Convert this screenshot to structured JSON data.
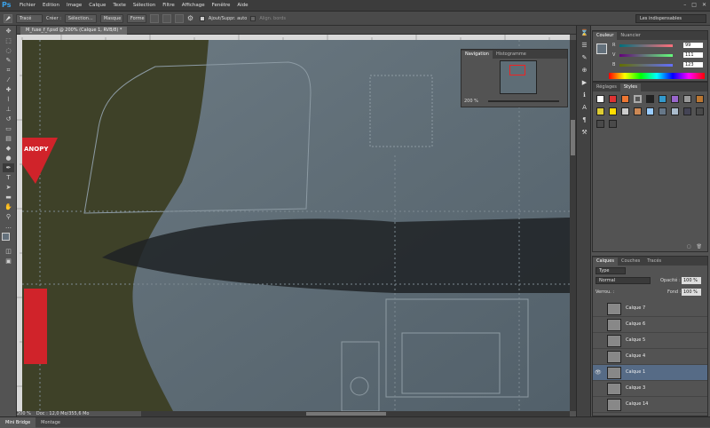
{
  "app": {
    "logo": "Ps"
  },
  "menu": [
    "Fichier",
    "Edition",
    "Image",
    "Calque",
    "Texte",
    "Sélection",
    "Filtre",
    "Affichage",
    "Fenêtre",
    "Aide"
  ],
  "window_controls": [
    "–",
    "□",
    "✕"
  ],
  "options": {
    "tool_dropdown": "Tracé",
    "create_label": "Créer :",
    "btn_selection": "Sélection...",
    "btn_mask": "Masque",
    "btn_shape": "Forme",
    "auto_add_label": "Ajout/Suppr. auto",
    "align_edges_label": "Align. bords",
    "workspace": "Les indispensables"
  },
  "document": {
    "tab_label": "M_fuse_f_f.psd @ 200% (Calque 1, RVB/8) *",
    "zoom": "200 %",
    "doc_info": "Doc : 12,0 Mo/355,6 Mo",
    "canvas_text": "ANOPY"
  },
  "navigator": {
    "tabs": [
      "Navigation",
      "Histogramme"
    ],
    "zoom": "200 %"
  },
  "color": {
    "tabs": [
      "Couleur",
      "Nuancier"
    ],
    "channels": [
      {
        "label": "R",
        "value": "99"
      },
      {
        "label": "V",
        "value": "111"
      },
      {
        "label": "B",
        "value": "123"
      }
    ]
  },
  "styles": {
    "tabs": [
      "Réglages",
      "Styles"
    ]
  },
  "layers": {
    "tabs": [
      "Calques",
      "Couches",
      "Tracés"
    ],
    "filter": "Type",
    "blend_mode": "Normal",
    "opacity_label": "Opacité :",
    "opacity": "100 %",
    "lock_label": "Verrou. :",
    "fill_label": "Fond :",
    "fill": "100 %",
    "items": [
      {
        "name": "Calque 7",
        "visible": false,
        "selected": false
      },
      {
        "name": "Calque 6",
        "visible": false,
        "selected": false
      },
      {
        "name": "Calque 5",
        "visible": false,
        "selected": false
      },
      {
        "name": "Calque 4",
        "visible": false,
        "selected": false
      },
      {
        "name": "Calque 1",
        "visible": true,
        "selected": true
      },
      {
        "name": "Calque 3",
        "visible": false,
        "selected": false
      },
      {
        "name": "Calque 14",
        "visible": false,
        "selected": false
      }
    ]
  },
  "bottom_tabs": [
    "Mini Bridge",
    "Montage"
  ]
}
